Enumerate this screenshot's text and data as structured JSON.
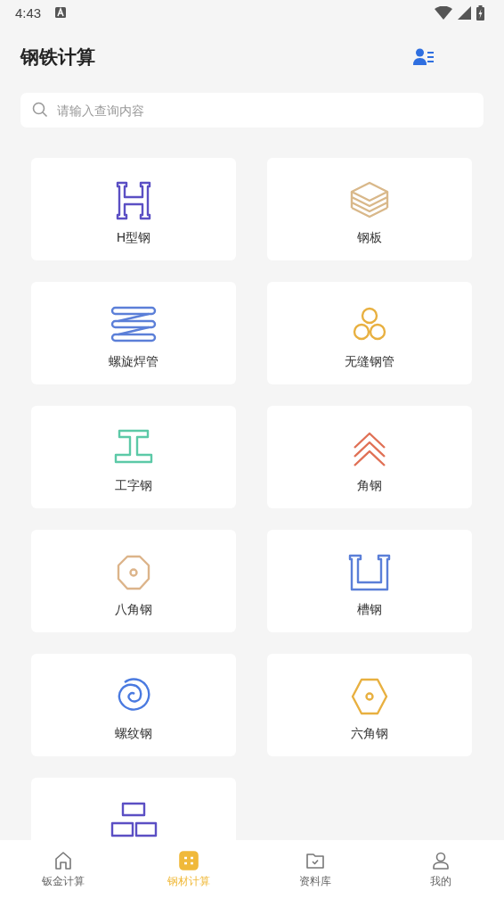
{
  "status_bar": {
    "time": "4:43"
  },
  "header": {
    "title": "钢铁计算"
  },
  "search": {
    "placeholder": "请输入查询内容"
  },
  "items": [
    {
      "label": "H型钢",
      "kind": "h-beam",
      "color": "#5b4fc4"
    },
    {
      "label": "钢板",
      "kind": "plates",
      "color": "#d9b88a"
    },
    {
      "label": "螺旋焊管",
      "kind": "spiral-pipe",
      "color": "#5b7fd8"
    },
    {
      "label": "无缝钢管",
      "kind": "pipes",
      "color": "#e8b040"
    },
    {
      "label": "工字钢",
      "kind": "i-beam",
      "color": "#5cc9a7"
    },
    {
      "label": "角钢",
      "kind": "chevrons",
      "color": "#e07055"
    },
    {
      "label": "八角钢",
      "kind": "octagon",
      "color": "#dcb48a"
    },
    {
      "label": "槽钢",
      "kind": "channel",
      "color": "#5b7fd8"
    },
    {
      "label": "螺纹钢",
      "kind": "spiral",
      "color": "#4a7ae0"
    },
    {
      "label": "六角钢",
      "kind": "hexagon",
      "color": "#e8b040"
    },
    {
      "kind": "bricks",
      "color": "#5b4fc4"
    }
  ],
  "nav": [
    {
      "label": "钣金计算",
      "kind": "home",
      "selected": false
    },
    {
      "label": "钢材计算",
      "kind": "grid",
      "selected": true
    },
    {
      "label": "资料库",
      "kind": "folder",
      "selected": false
    },
    {
      "label": "我的",
      "kind": "person",
      "selected": false
    }
  ]
}
